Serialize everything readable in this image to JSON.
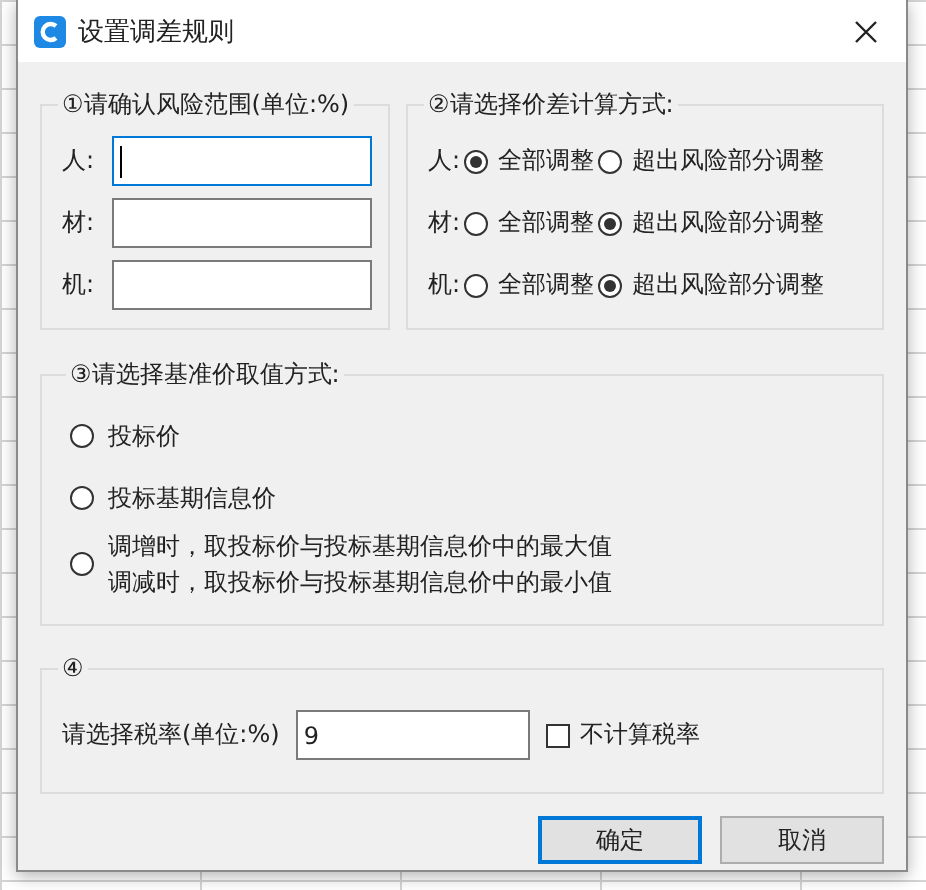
{
  "window": {
    "title": "设置调差规则"
  },
  "risk_range": {
    "title": "①请确认风险范围(单位:%)",
    "fields": [
      {
        "label": "人:",
        "focused": true
      },
      {
        "label": "材:",
        "focused": false
      },
      {
        "label": "机:",
        "focused": false
      }
    ]
  },
  "calc_method": {
    "title": "②请选择价差计算方式:",
    "rows": [
      {
        "label": "人:",
        "options": [
          {
            "label": "全部调整",
            "selected": true
          },
          {
            "label": "超出风险部分调整",
            "selected": false
          }
        ]
      },
      {
        "label": "材:",
        "options": [
          {
            "label": "全部调整",
            "selected": false
          },
          {
            "label": "超出风险部分调整",
            "selected": true
          }
        ]
      },
      {
        "label": "机:",
        "options": [
          {
            "label": "全部调整",
            "selected": false
          },
          {
            "label": "超出风险部分调整",
            "selected": true
          }
        ]
      }
    ]
  },
  "base_price": {
    "title": "③请选择基准价取值方式:",
    "options": [
      {
        "lines": [
          "投标价"
        ],
        "selected": false
      },
      {
        "lines": [
          "投标基期信息价"
        ],
        "selected": false
      },
      {
        "lines": [
          "调增时，取投标价与投标基期信息价中的最大值",
          "调减时，取投标价与投标基期信息价中的最小值"
        ],
        "selected": false
      }
    ]
  },
  "tax": {
    "title": "④",
    "label": "请选择税率(单位:%)",
    "value": "9",
    "checkbox": {
      "label": "不计算税率",
      "checked": false
    }
  },
  "buttons": [
    {
      "label": "确定",
      "default": true
    },
    {
      "label": "取消",
      "default": false
    }
  ]
}
